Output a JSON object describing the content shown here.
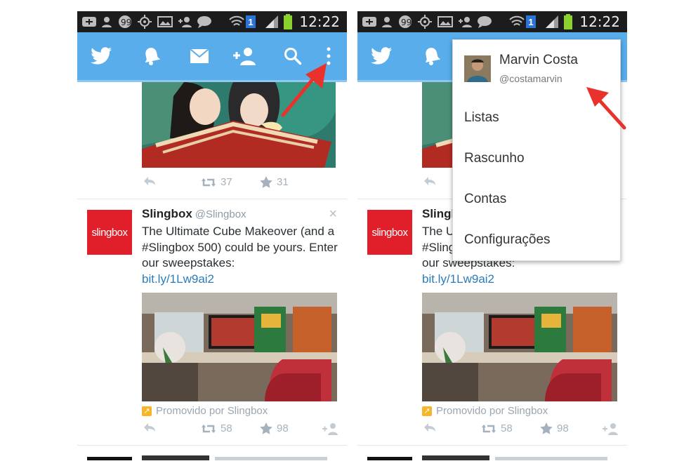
{
  "statusbar": {
    "time": "12:22",
    "sim": "1"
  },
  "appbar": {
    "icons": [
      "twitter-bird-icon",
      "bell-icon",
      "envelope-icon",
      "add-user-icon",
      "search-icon",
      "overflow-menu-icon"
    ]
  },
  "tweet_top": {
    "retweets": "37",
    "favorites": "31"
  },
  "tweet": {
    "avatar_text": "slingbox",
    "name": "Slingbox",
    "handle": "@Slingbox",
    "close": "×",
    "text": "The Ultimate Cube Makeover (and a #Slingbox 500) could be yours. Enter our sweepstakes:",
    "link": "bit.ly/1Lw9ai2",
    "promoted": "Promovido por Slingbox",
    "retweets": "58",
    "favorites": "98"
  },
  "menu": {
    "name": "Marvin Costa",
    "handle": "@costamarvin",
    "items": [
      "Listas",
      "Rascunho",
      "Contas",
      "Configurações"
    ]
  },
  "colors": {
    "appbar": "#59adeb",
    "link": "#2b7bb9",
    "slingbox_red": "#e01f2a",
    "arrow_red": "#e8322b"
  }
}
